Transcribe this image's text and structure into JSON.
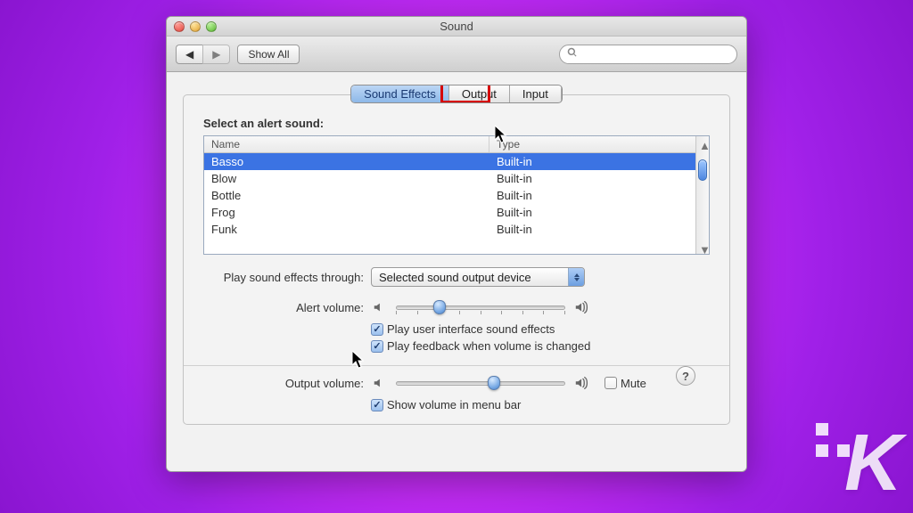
{
  "window": {
    "title": "Sound"
  },
  "toolbar": {
    "back_icon": "chevron-left",
    "forward_icon": "chevron-right",
    "show_all": "Show All",
    "search_placeholder": ""
  },
  "tabs": [
    {
      "id": "sound-effects",
      "label": "Sound Effects",
      "selected": true
    },
    {
      "id": "output",
      "label": "Output",
      "selected": false,
      "highlighted": true
    },
    {
      "id": "input",
      "label": "Input",
      "selected": false
    }
  ],
  "alert_sounds": {
    "heading": "Select an alert sound:",
    "columns": {
      "name": "Name",
      "type": "Type"
    },
    "rows": [
      {
        "name": "Basso",
        "type": "Built-in",
        "selected": true
      },
      {
        "name": "Blow",
        "type": "Built-in"
      },
      {
        "name": "Bottle",
        "type": "Built-in"
      },
      {
        "name": "Frog",
        "type": "Built-in"
      },
      {
        "name": "Funk",
        "type": "Built-in"
      }
    ]
  },
  "play_through": {
    "label": "Play sound effects through:",
    "value": "Selected sound output device"
  },
  "alert_volume": {
    "label": "Alert volume:",
    "percent": 26
  },
  "ui_sounds_checkbox": {
    "label": "Play user interface sound effects",
    "checked": true
  },
  "feedback_checkbox": {
    "label": "Play feedback when volume is changed",
    "checked": true
  },
  "output_volume": {
    "label": "Output volume:",
    "percent": 58
  },
  "mute_checkbox": {
    "label": "Mute",
    "checked": false
  },
  "menubar_checkbox": {
    "label": "Show volume in menu bar",
    "checked": true
  },
  "help_tooltip": "?"
}
